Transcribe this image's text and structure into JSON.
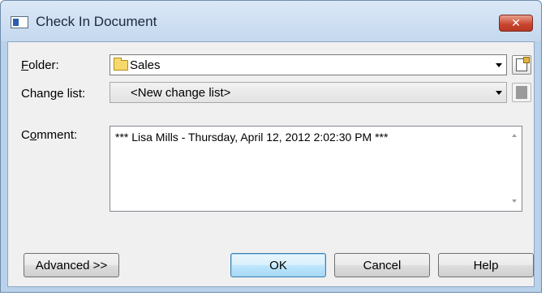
{
  "window": {
    "title": "Check In Document",
    "close_label": "✕"
  },
  "folder": {
    "label_accel": "F",
    "label_rest": "older:",
    "value": "Sales"
  },
  "change_list": {
    "label": "Change list:",
    "value": "<New change list>"
  },
  "comment": {
    "label_pre": "C",
    "label_accel": "o",
    "label_rest": "mment:",
    "value": "*** Lisa Mills - Thursday, April 12, 2012 2:02:30 PM ***"
  },
  "buttons": {
    "advanced": "Advanced >>",
    "ok": "OK",
    "cancel": "Cancel",
    "help": "Help"
  },
  "icons": {
    "app": "window-icon",
    "folder": "folder-icon",
    "properties": "properties-icon",
    "dropdown": "chevron-down-icon"
  },
  "colors": {
    "title_bar": "#c4d8ee",
    "close_button": "#c8432c",
    "default_button": "#bee6fd",
    "dialog_bg": "#f0f0f0"
  }
}
